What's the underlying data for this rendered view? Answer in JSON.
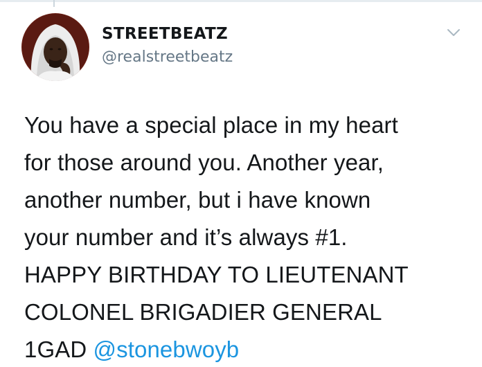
{
  "tweet": {
    "author": {
      "display_name": "STREETBEATZ",
      "handle": "@realstreetbeatz",
      "avatar_icon": "profile-photo"
    },
    "menu_icon": "chevron-down-icon",
    "body_lines": [
      "You have a special place in my heart",
      "for those around you. Another year,",
      "another number, but i have known",
      "your number and it’s always #1.",
      "HAPPY BIRTHDAY TO LIEUTENANT",
      "COLONEL BRIGADIER GENERAL"
    ],
    "last_line_prefix": "1GAD ",
    "mention": "@stonebwoyb"
  },
  "colors": {
    "text": "#14171a",
    "secondary": "#657786",
    "link": "#1b95e0",
    "divider": "#e6ecf0"
  }
}
